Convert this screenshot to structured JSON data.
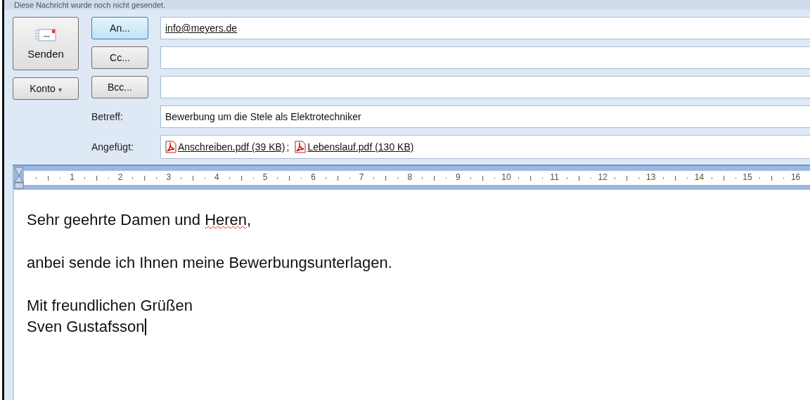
{
  "info_bar": {
    "text": "Diese Nachricht wurde noch nicht gesendet."
  },
  "send_button": {
    "label": "Senden"
  },
  "account_button": {
    "label": "Konto",
    "caret": "▾"
  },
  "address_rows": [
    {
      "button": "An...",
      "selected": true,
      "value": "info@meyers.de"
    },
    {
      "button": "Cc...",
      "selected": false,
      "value": ""
    },
    {
      "button": "Bcc...",
      "selected": false,
      "value": ""
    }
  ],
  "subject": {
    "label": "Betreff:",
    "value": "Bewerbung um die Stele als Elektrotechniker"
  },
  "attachments": {
    "label": "Angefügt:",
    "separator": ";",
    "files": [
      {
        "name": "Anschreiben.pdf (39 KB)"
      },
      {
        "name": "Lebenslauf.pdf (130 KB)"
      }
    ]
  },
  "ruler": {
    "numbers": [
      "1",
      "2",
      "3",
      "4",
      "5",
      "6",
      "7",
      "8",
      "9",
      "10",
      "11",
      "12",
      "13",
      "14",
      "15",
      "16"
    ]
  },
  "body": {
    "paragraphs": [
      {
        "lines": [
          {
            "parts": [
              {
                "text": "Sehr geehrte Damen und ",
                "misspelled": false
              },
              {
                "text": "Heren",
                "misspelled": true
              },
              {
                "text": ",",
                "misspelled": false
              }
            ]
          }
        ]
      },
      {
        "lines": [
          {
            "parts": [
              {
                "text": "anbei sende ich Ihnen meine Bewerbungsunterlagen.",
                "misspelled": false
              }
            ]
          }
        ]
      },
      {
        "lines": [
          {
            "parts": [
              {
                "text": "Mit freundlichen Grüßen",
                "misspelled": false
              }
            ]
          },
          {
            "parts": [
              {
                "text": "Sven Gustafsson",
                "misspelled": false
              }
            ]
          }
        ]
      }
    ],
    "cursor_after_last": true
  }
}
